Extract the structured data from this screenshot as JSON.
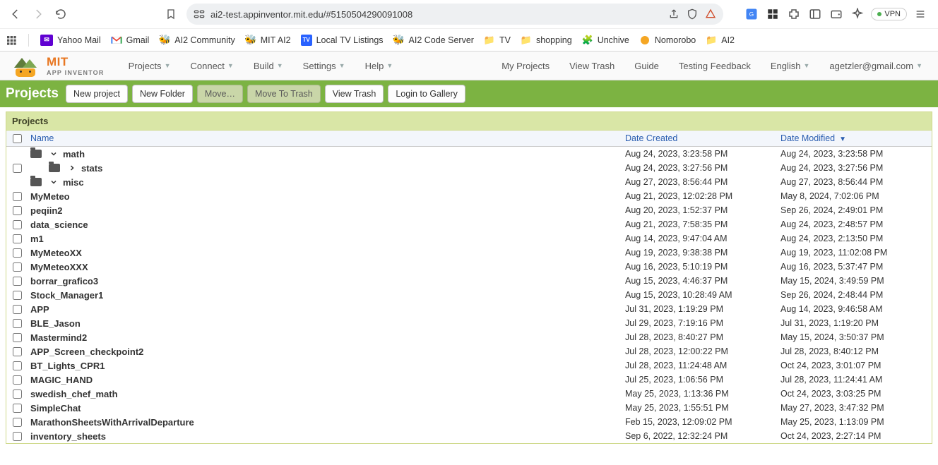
{
  "browser": {
    "url": "ai2-test.appinventor.mit.edu/#5150504290091008",
    "vpn_label": "VPN"
  },
  "bookmarks": {
    "items": [
      {
        "label": "Yahoo Mail"
      },
      {
        "label": "Gmail"
      },
      {
        "label": "AI2 Community"
      },
      {
        "label": "MIT AI2"
      },
      {
        "label": "Local TV Listings"
      },
      {
        "label": "AI2 Code Server"
      },
      {
        "label": "TV"
      },
      {
        "label": "shopping"
      },
      {
        "label": "Unchive"
      },
      {
        "label": "Nomorobo"
      },
      {
        "label": "AI2"
      }
    ]
  },
  "logo": {
    "line1": "MIT",
    "line2": "APP INVENTOR"
  },
  "menus": {
    "left": [
      {
        "label": "Projects"
      },
      {
        "label": "Connect"
      },
      {
        "label": "Build"
      },
      {
        "label": "Settings"
      },
      {
        "label": "Help"
      }
    ],
    "right": [
      {
        "label": "My Projects"
      },
      {
        "label": "View Trash"
      },
      {
        "label": "Guide"
      },
      {
        "label": "Testing Feedback"
      },
      {
        "label": "English"
      },
      {
        "label": "agetzler@gmail.com"
      }
    ]
  },
  "actions": {
    "title": "Projects",
    "btn_new_project": "New project",
    "btn_new_folder": "New Folder",
    "btn_move": "Move…",
    "btn_move_trash": "Move To Trash",
    "btn_view_trash": "View Trash",
    "btn_login_gallery": "Login to Gallery"
  },
  "panel": {
    "title": "Projects"
  },
  "table": {
    "headers": {
      "name": "Name",
      "created": "Date Created",
      "modified": "Date Modified"
    },
    "rows": [
      {
        "type": "folder",
        "indent": 0,
        "expand": "down",
        "checkbox": false,
        "name": "math",
        "created": "Aug 24, 2023, 3:23:58 PM",
        "modified": "Aug 24, 2023, 3:23:58 PM"
      },
      {
        "type": "folder",
        "indent": 1,
        "expand": "right",
        "checkbox": true,
        "name": "stats",
        "created": "Aug 24, 2023, 3:27:56 PM",
        "modified": "Aug 24, 2023, 3:27:56 PM"
      },
      {
        "type": "folder",
        "indent": 0,
        "expand": "down",
        "checkbox": false,
        "name": "misc",
        "created": "Aug 27, 2023, 8:56:44 PM",
        "modified": "Aug 27, 2023, 8:56:44 PM"
      },
      {
        "type": "project",
        "indent": 0,
        "checkbox": true,
        "name": "MyMeteo",
        "created": "Aug 21, 2023, 12:02:28 PM",
        "modified": "May 8, 2024, 7:02:06 PM"
      },
      {
        "type": "project",
        "indent": 0,
        "checkbox": true,
        "name": "peqiin2",
        "created": "Aug 20, 2023, 1:52:37 PM",
        "modified": "Sep 26, 2024, 2:49:01 PM"
      },
      {
        "type": "project",
        "indent": 0,
        "checkbox": true,
        "name": "data_science",
        "created": "Aug 21, 2023, 7:58:35 PM",
        "modified": "Aug 24, 2023, 2:48:57 PM"
      },
      {
        "type": "project",
        "indent": 0,
        "checkbox": true,
        "name": "m1",
        "created": "Aug 14, 2023, 9:47:04 AM",
        "modified": "Aug 24, 2023, 2:13:50 PM"
      },
      {
        "type": "project",
        "indent": 0,
        "checkbox": true,
        "name": "MyMeteoXX",
        "created": "Aug 19, 2023, 9:38:38 PM",
        "modified": "Aug 19, 2023, 11:02:08 PM"
      },
      {
        "type": "project",
        "indent": 0,
        "checkbox": true,
        "name": "MyMeteoXXX",
        "created": "Aug 16, 2023, 5:10:19 PM",
        "modified": "Aug 16, 2023, 5:37:47 PM"
      },
      {
        "type": "project",
        "indent": 0,
        "checkbox": true,
        "name": "borrar_grafico3",
        "created": "Aug 15, 2023, 4:46:37 PM",
        "modified": "May 15, 2024, 3:49:59 PM"
      },
      {
        "type": "project",
        "indent": 0,
        "checkbox": true,
        "name": "Stock_Manager1",
        "created": "Aug 15, 2023, 10:28:49 AM",
        "modified": "Sep 26, 2024, 2:48:44 PM"
      },
      {
        "type": "project",
        "indent": 0,
        "checkbox": true,
        "name": "APP",
        "created": "Jul 31, 2023, 1:19:29 PM",
        "modified": "Aug 14, 2023, 9:46:58 AM"
      },
      {
        "type": "project",
        "indent": 0,
        "checkbox": true,
        "name": "BLE_Jason",
        "created": "Jul 29, 2023, 7:19:16 PM",
        "modified": "Jul 31, 2023, 1:19:20 PM"
      },
      {
        "type": "project",
        "indent": 0,
        "checkbox": true,
        "name": "Mastermind2",
        "created": "Jul 28, 2023, 8:40:27 PM",
        "modified": "May 15, 2024, 3:50:37 PM"
      },
      {
        "type": "project",
        "indent": 0,
        "checkbox": true,
        "name": "APP_Screen_checkpoint2",
        "created": "Jul 28, 2023, 12:00:22 PM",
        "modified": "Jul 28, 2023, 8:40:12 PM"
      },
      {
        "type": "project",
        "indent": 0,
        "checkbox": true,
        "name": "BT_Lights_CPR1",
        "created": "Jul 28, 2023, 11:24:48 AM",
        "modified": "Oct 24, 2023, 3:01:07 PM"
      },
      {
        "type": "project",
        "indent": 0,
        "checkbox": true,
        "name": "MAGIC_HAND",
        "created": "Jul 25, 2023, 1:06:56 PM",
        "modified": "Jul 28, 2023, 11:24:41 AM"
      },
      {
        "type": "project",
        "indent": 0,
        "checkbox": true,
        "name": "swedish_chef_math",
        "created": "May 25, 2023, 1:13:36 PM",
        "modified": "Oct 24, 2023, 3:03:25 PM"
      },
      {
        "type": "project",
        "indent": 0,
        "checkbox": true,
        "name": "SimpleChat",
        "created": "May 25, 2023, 1:55:51 PM",
        "modified": "May 27, 2023, 3:47:32 PM"
      },
      {
        "type": "project",
        "indent": 0,
        "checkbox": true,
        "name": "MarathonSheetsWithArrivalDeparture",
        "created": "Feb 15, 2023, 12:09:02 PM",
        "modified": "May 25, 2023, 1:13:09 PM"
      },
      {
        "type": "project",
        "indent": 0,
        "checkbox": true,
        "name": "inventory_sheets",
        "created": "Sep 6, 2022, 12:32:24 PM",
        "modified": "Oct 24, 2023, 2:27:14 PM"
      }
    ]
  }
}
